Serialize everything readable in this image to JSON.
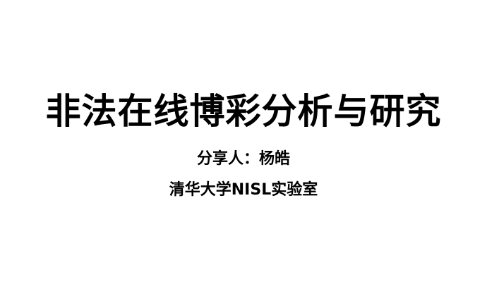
{
  "slide": {
    "title": "非法在线博彩分析与研究",
    "speaker": "分享人：杨皓",
    "affiliation": "清华大学NISL实验室"
  }
}
